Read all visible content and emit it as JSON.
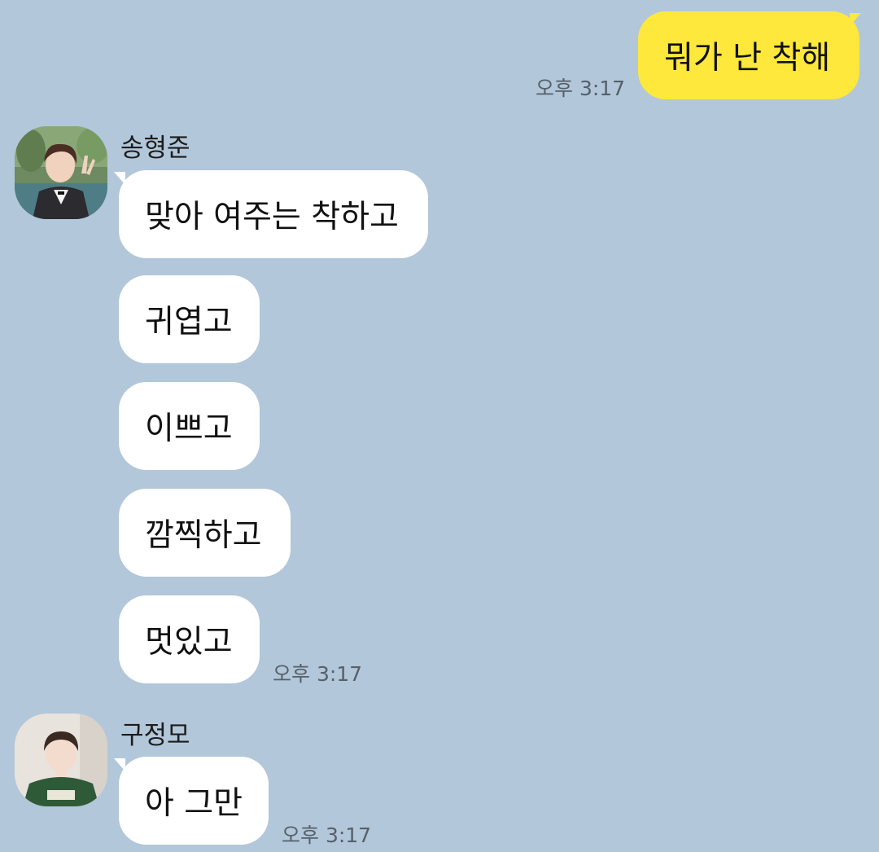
{
  "colors": {
    "background": "#b2c7d9",
    "my_bubble": "#fee83c",
    "their_bubble": "#ffffff",
    "timestamp": "#55606b"
  },
  "messages_out": [
    {
      "text": "뭐가 난 착해",
      "time": "오후 3:17"
    }
  ],
  "senders": [
    {
      "name": "송형준",
      "avatar_icon": "profile-photo-icon",
      "messages": [
        "맞아 여주는 착하고",
        "귀엽고",
        "이쁘고",
        "깜찍하고",
        "멋있고"
      ],
      "time": "오후 3:17"
    },
    {
      "name": "구정모",
      "avatar_icon": "profile-photo-icon",
      "messages": [
        "아 그만"
      ],
      "time": "오후 3:17"
    }
  ]
}
